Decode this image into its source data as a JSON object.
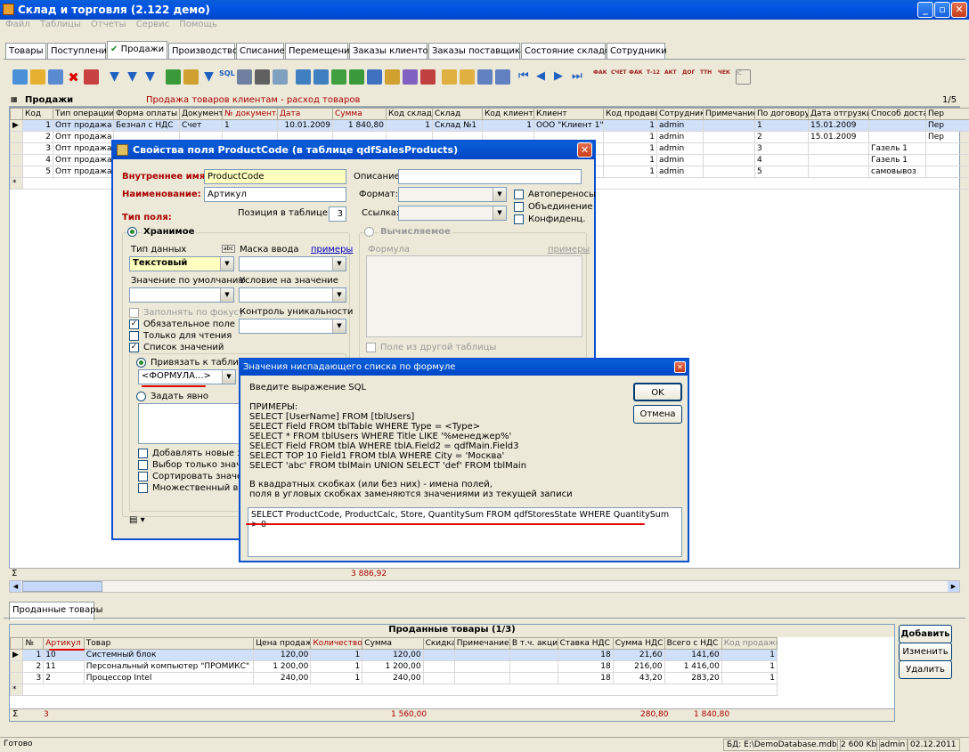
{
  "window": {
    "title": "Склад и торговля (2.122 демо)"
  },
  "menu": [
    "Файл",
    "Таблицы",
    "Отчеты",
    "Сервис",
    "Помощь"
  ],
  "tabs": [
    "Товары",
    "Поступление",
    "Продажи",
    "Производство",
    "Списание",
    "Перемещение",
    "Заказы клиентов",
    "Заказы поставщикам",
    "Состояние складов",
    "Сотрудники"
  ],
  "grid": {
    "title": "Продажи",
    "subtitle": "Продажа товаров клиентам - расход товаров",
    "page": "1/5",
    "columns": [
      "Код",
      "Тип операции",
      "Форма оплаты",
      "Документ",
      "№ документа",
      "Дата",
      "Сумма",
      "Код склада",
      "Склад",
      "Код клиента",
      "Клиент",
      "Код продавца",
      "Сотрудник",
      "Примечание",
      "По договору",
      "Дата отгрузки",
      "Способ доставки",
      "Пер"
    ],
    "rows": [
      [
        "1",
        "Опт продажа",
        "Безнал с НДС",
        "Счет",
        "1",
        "10.01.2009",
        "1 840,80",
        "1",
        "Склад №1",
        "1",
        "ООО \"Клиент 1\"",
        "1",
        "admin",
        "",
        "1",
        "15.01.2009",
        "",
        "Пер"
      ],
      [
        "2",
        "Опт продажа",
        "",
        "",
        "",
        "",
        "",
        "",
        "",
        "",
        "",
        "1",
        "admin",
        "",
        "2",
        "15.01.2009",
        "",
        "Пер"
      ],
      [
        "3",
        "Опт продажа",
        "",
        "",
        "",
        "",
        "",
        "",
        "",
        "",
        "",
        "1",
        "admin",
        "",
        "3",
        "",
        "Газель 1",
        ""
      ],
      [
        "4",
        "Опт продажа",
        "",
        "",
        "",
        "",
        "",
        "",
        "",
        "",
        "",
        "1",
        "admin",
        "",
        "4",
        "",
        "Газель 1",
        ""
      ],
      [
        "5",
        "Опт продажа",
        "",
        "",
        "",
        "",
        "",
        "",
        "",
        "",
        "",
        "1",
        "admin",
        "",
        "5",
        "",
        "самовывоз",
        ""
      ]
    ],
    "sum": "3 886,92"
  },
  "dialog1": {
    "title": "Свойства поля ProductCode (в таблице qdfSalesProducts)",
    "internal_name_label": "Внутреннее имя:",
    "internal_name": "ProductCode",
    "name_label": "Наименование:",
    "name": "Артикул",
    "field_type_label": "Тип поля:",
    "position_label": "Позиция в таблице:",
    "position": "3",
    "description_label": "Описание:",
    "format_label": "Формат:",
    "link_label": "Ссылка:",
    "autowrap": "Автопереносы",
    "merge": "Объединение",
    "confidential": "Конфиденц.",
    "stored": "Хранимое",
    "datatype_label": "Тип данных",
    "datatype": "Текстовый",
    "mask_label": "Маска ввода",
    "examples": "примеры",
    "default_label": "Значение по умолчанию",
    "condition_label": "Условие на значение",
    "fill_focus": "Заполнять по фокусу",
    "required": "Обязательное поле",
    "readonly": "Только для чтения",
    "unique_label": "Контроль уникальности",
    "value_list": "Список значений",
    "bind_table": "Привязать к таблице",
    "formula_value": "<ФОРМУЛА...>",
    "set_explicit": "Задать явно",
    "add_new": "Добавлять новые значения",
    "select_only": "Выбор только значения",
    "sort_values": "Сортировать значения",
    "multi_select": "Множественный выбор",
    "computed": "Вычисляемое",
    "formula_label": "Формула",
    "from_other": "Поле из другой таблицы"
  },
  "dialog2": {
    "title": "Значения ниспадающего списка по формуле",
    "prompt": "Введите выражение SQL",
    "examples_header": "ПРИМЕРЫ:",
    "examples": [
      "SELECT [UserName] FROM [tblUsers]",
      "SELECT Field FROM tblTable WHERE Type = <Type>",
      "SELECT * FROM tblUsers WHERE Title LIKE '%менеджер%'",
      "SELECT Field FROM tblA WHERE tblA.Field2 = qdfMain.Field3",
      "SELECT TOP 10 Field1 FROM tblA WHERE City = 'Москва'",
      "SELECT 'abc' FROM tblMain UNION SELECT 'def' FROM tblMain"
    ],
    "note1": "В квадратных скобках (или без них) - имена полей,",
    "note2": "поля в угловых скобках заменяются значениями из текущей записи",
    "sql": "SELECT ProductCode, ProductCalc, Store, QuantitySum FROM qdfStoresState WHERE QuantitySum > 0",
    "ok": "OK",
    "cancel": "Отмена"
  },
  "bottom": {
    "tab": "Проданные товары",
    "title": "Проданные товары (1/3)",
    "columns": [
      "№",
      "Артикул",
      "Товар",
      "Цена продажи",
      "Количество",
      "Сумма",
      "Скидка",
      "Примечание",
      "В т.ч. акциз",
      "Ставка НДС",
      "Сумма НДС",
      "Всего с НДС",
      "Код продажи"
    ],
    "rows": [
      [
        "1",
        "10",
        "Системный блок",
        "120,00",
        "1",
        "120,00",
        "",
        "",
        "",
        "18",
        "21,60",
        "141,60",
        "1"
      ],
      [
        "2",
        "11",
        "Персональный компьютер \"ПРОМИКС\"",
        "1 200,00",
        "1",
        "1 200,00",
        "",
        "",
        "",
        "18",
        "216,00",
        "1 416,00",
        "1"
      ],
      [
        "3",
        "2",
        "Процессор Intel",
        "240,00",
        "1",
        "240,00",
        "",
        "",
        "",
        "18",
        "43,20",
        "283,20",
        "1"
      ]
    ],
    "sum_count": "3",
    "sum_total": "1 560,00",
    "sum_vat": "280,80",
    "sum_all": "1 840,80",
    "add": "Добавить",
    "edit": "Изменить",
    "delete": "Удалить"
  },
  "status": {
    "ready": "Готово",
    "db_label": "БД:",
    "db_path": "E:\\DemoDatabase.mdb",
    "size": "2 600 Kb",
    "user": "admin",
    "date": "02.12.2011"
  },
  "sigma": "Σ",
  "new_row": "*"
}
